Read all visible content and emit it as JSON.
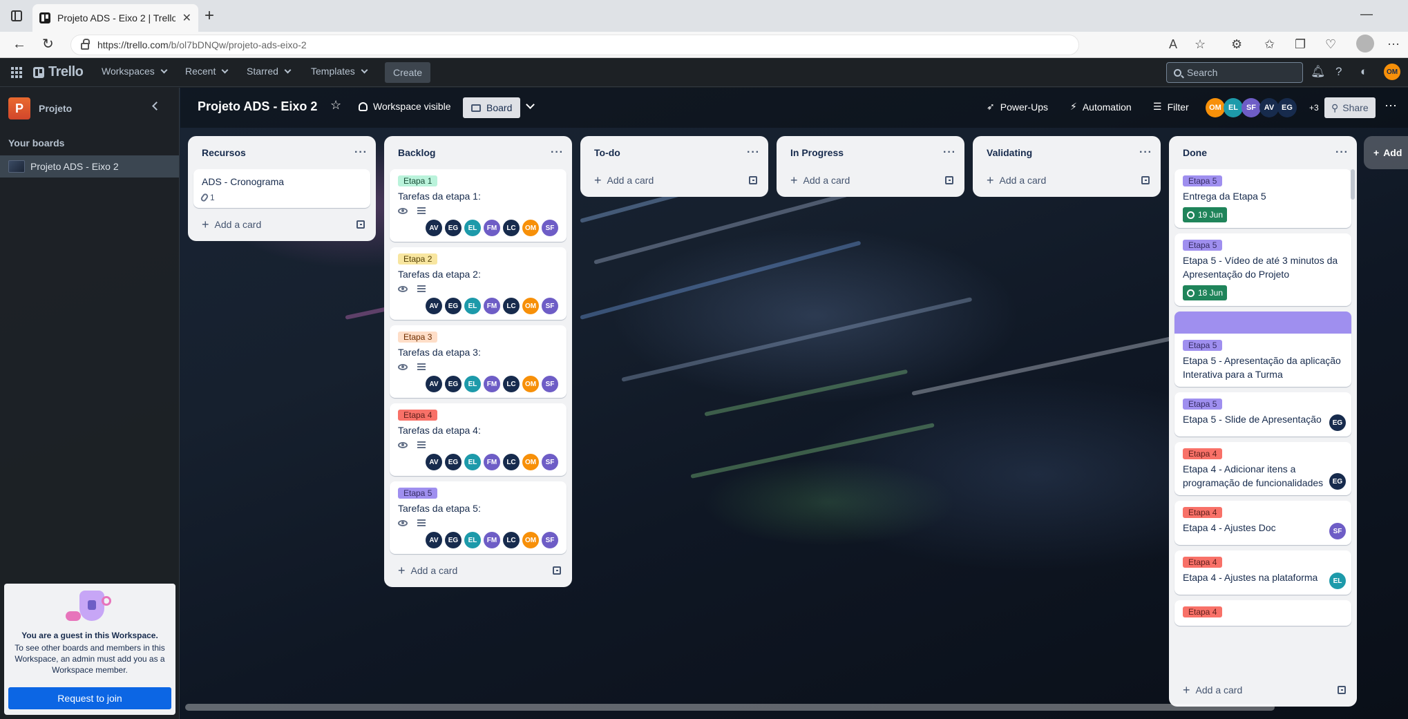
{
  "browser": {
    "tab_title": "Projeto ADS - Eixo 2 | Trello",
    "url_host": "https://trello.com",
    "url_path": "/b/ol7bDNQw/projeto-ads-eixo-2"
  },
  "header": {
    "logo": "Trello",
    "menus": [
      "Workspaces",
      "Recent",
      "Starred",
      "Templates"
    ],
    "create_label": "Create",
    "search_placeholder": "Search",
    "user_initials": "OM"
  },
  "sidebar": {
    "workspace_initial": "P",
    "workspace_name": "Projeto",
    "your_boards": "Your boards",
    "boards": [
      "Projeto ADS - Eixo 2"
    ],
    "guest": {
      "title": "You are a guest in this Workspace.",
      "text": "To see other boards and members in this Workspace, an admin must add you as a Workspace member.",
      "button": "Request to join"
    }
  },
  "board": {
    "title": "Projeto ADS - Eixo 2",
    "visibility": "Workspace visible",
    "view": "Board",
    "power_ups": "Power-Ups",
    "automation": "Automation",
    "filter": "Filter",
    "members": [
      {
        "initials": "OM",
        "color": "#f79009"
      },
      {
        "initials": "EL",
        "color": "#1d9aaa"
      },
      {
        "initials": "SF",
        "color": "#6e5dc6"
      },
      {
        "initials": "AV",
        "color": "#172b4d"
      },
      {
        "initials": "EG",
        "color": "#172b4d"
      }
    ],
    "more_members": "+3",
    "share": "Share",
    "add_list": "Add"
  },
  "add_card_label": "Add a card",
  "member_colors": {
    "AV": "#172b4d",
    "EG": "#172b4d",
    "EL": "#1d9aaa",
    "FM": "#6e5dc6",
    "LC": "#172b4d",
    "OM": "#f79009",
    "SF": "#6e5dc6"
  },
  "label_styles": {
    "Etapa 1": {
      "bg": "#baf3db",
      "fg": "#164b35"
    },
    "Etapa 2": {
      "bg": "#f8e6a0",
      "fg": "#533f04"
    },
    "Etapa 3": {
      "bg": "#fedec8",
      "fg": "#702e00"
    },
    "Etapa 4": {
      "bg": "#f87168",
      "fg": "#5d1f1a"
    },
    "Etapa 5": {
      "bg": "#9f8fef",
      "fg": "#352c63"
    }
  },
  "lists": [
    {
      "title": "Recursos",
      "cards": [
        {
          "title": "ADS - Cronograma",
          "attachments": "1"
        }
      ]
    },
    {
      "title": "Backlog",
      "cards": [
        {
          "label": "Etapa 1",
          "title": "Tarefas da etapa 1:",
          "watch": true,
          "description": true,
          "members": [
            "AV",
            "EG",
            "EL",
            "FM",
            "LC",
            "OM",
            "SF"
          ]
        },
        {
          "label": "Etapa 2",
          "title": "Tarefas da etapa 2:",
          "watch": true,
          "description": true,
          "members": [
            "AV",
            "EG",
            "EL",
            "FM",
            "LC",
            "OM",
            "SF"
          ]
        },
        {
          "label": "Etapa 3",
          "title": "Tarefas da etapa 3:",
          "watch": true,
          "description": true,
          "members": [
            "AV",
            "EG",
            "EL",
            "FM",
            "LC",
            "OM",
            "SF"
          ]
        },
        {
          "label": "Etapa 4",
          "title": "Tarefas da etapa 4:",
          "watch": true,
          "description": true,
          "members": [
            "AV",
            "EG",
            "EL",
            "FM",
            "LC",
            "OM",
            "SF"
          ]
        },
        {
          "label": "Etapa 5",
          "title": "Tarefas da etapa 5:",
          "watch": true,
          "description": true,
          "members": [
            "AV",
            "EG",
            "EL",
            "FM",
            "LC",
            "OM",
            "SF"
          ]
        }
      ]
    },
    {
      "title": "To-do",
      "cards": []
    },
    {
      "title": "In Progress",
      "cards": []
    },
    {
      "title": "Validating",
      "cards": []
    },
    {
      "title": "Done",
      "cards": [
        {
          "label": "Etapa 5",
          "title": "Entrega da Etapa 5",
          "due": "19 Jun"
        },
        {
          "label": "Etapa 5",
          "title": "Etapa 5 - Vídeo de até 3 minutos da Apresentação do Projeto",
          "due": "18 Jun"
        },
        {
          "cover": true,
          "label": "Etapa 5",
          "title": "Etapa 5 - Apresentação da aplicação Interativa para a Turma"
        },
        {
          "label": "Etapa 5",
          "title": "Etapa 5 - Slide de Apresentação",
          "members": [
            "EG"
          ]
        },
        {
          "label": "Etapa 4",
          "title": "Etapa 4 - Adicionar itens a programação de funcionalidades",
          "members": [
            "EG"
          ]
        },
        {
          "label": "Etapa 4",
          "title": "Etapa 4 - Ajustes Doc",
          "members": [
            "SF"
          ]
        },
        {
          "label": "Etapa 4",
          "title": "Etapa 4 - Ajustes na plataforma",
          "members": [
            "EL"
          ]
        },
        {
          "label": "Etapa 4",
          "title": ""
        }
      ]
    }
  ]
}
